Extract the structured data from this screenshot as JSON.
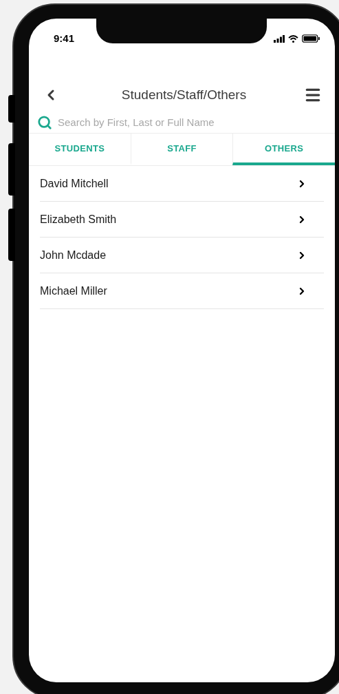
{
  "status_bar": {
    "time": "9:41"
  },
  "header": {
    "title": "Students/Staff/Others"
  },
  "search": {
    "placeholder": "Search by First, Last or Full Name"
  },
  "tabs": [
    {
      "label": "STUDENTS",
      "selected": false
    },
    {
      "label": "STAFF",
      "selected": false
    },
    {
      "label": "OTHERS",
      "selected": true
    }
  ],
  "people": [
    {
      "name": "David Mitchell"
    },
    {
      "name": "Elizabeth Smith"
    },
    {
      "name": "John Mcdade"
    },
    {
      "name": "Michael Miller"
    }
  ]
}
